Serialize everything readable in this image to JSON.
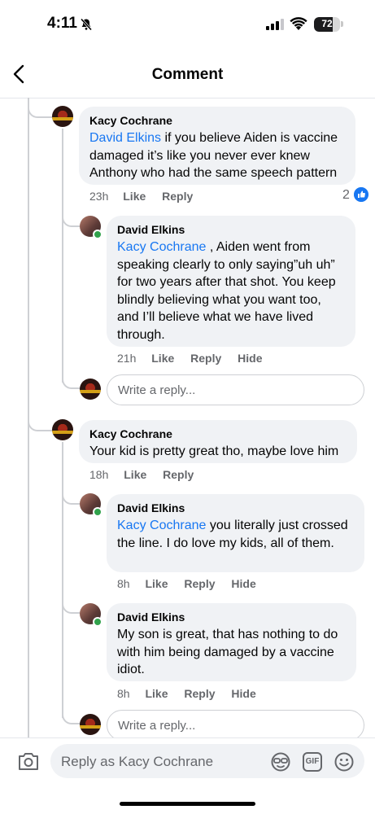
{
  "status_bar": {
    "time": "4:11",
    "battery": "72",
    "battery_level": 0.72
  },
  "header": {
    "title": "Comment"
  },
  "comments": [
    {
      "author": "Kacy Cochrane",
      "mention": "David Elkins",
      "text": " if you believe Aiden is vaccine damaged it’s like you never ever knew Anthony who had the same speech pattern",
      "time": "23h",
      "like": "Like",
      "reply": "Reply",
      "reactions": "2"
    },
    {
      "author": "David Elkins",
      "mention": "Kacy Cochrane",
      "text": " , Aiden went from speaking clearly to only saying”uh uh” for two years after that shot. You keep blindly believing what you want too, and I’ll believe what we have lived through.",
      "time": "21h",
      "like": "Like",
      "reply": "Reply",
      "hide": "Hide"
    },
    {
      "author": "Kacy Cochrane",
      "text": "Your kid is pretty great tho, maybe love him",
      "time": "18h",
      "like": "Like",
      "reply": "Reply"
    },
    {
      "author": "David Elkins",
      "mention": "Kacy Cochrane",
      "text": " you literally just crossed the line. I do love my kids, all of them.",
      "time": "8h",
      "like": "Like",
      "reply": "Reply",
      "hide": "Hide"
    },
    {
      "author": "David Elkins",
      "text": "My son is great, that has nothing to do with him being damaged by a vaccine idiot.",
      "time": "8h",
      "like": "Like",
      "reply": "Reply",
      "hide": "Hide"
    }
  ],
  "write_reply_placeholder": "Write a reply...",
  "composer": {
    "placeholder": "Reply as Kacy Cochrane",
    "gif_label": "GIF"
  },
  "icons": [
    "bell-slash-icon",
    "signal-icon",
    "wifi-icon",
    "battery-icon",
    "back-icon",
    "like-icon",
    "camera-icon",
    "avatar-sticker-icon",
    "gif-icon",
    "emoji-icon"
  ],
  "colors": {
    "link": "#1877f2",
    "bubble": "#f0f2f5",
    "meta": "#65676b",
    "online": "#31a24c"
  }
}
